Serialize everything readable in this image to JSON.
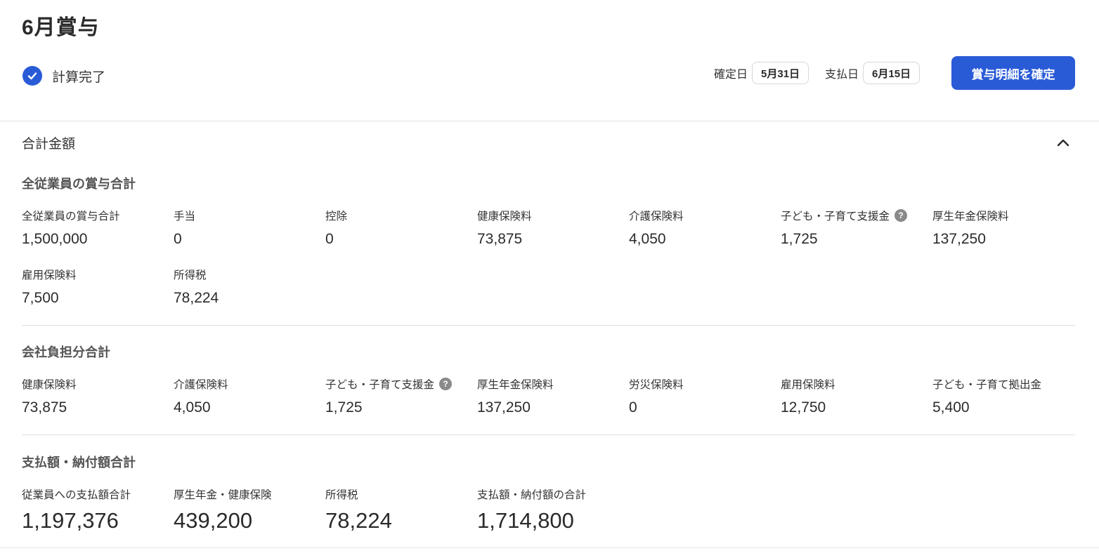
{
  "header": {
    "title": "6月賞与",
    "status_label": "計算完了",
    "confirm_date_label": "確定日",
    "confirm_date": "5月31日",
    "pay_date_label": "支払日",
    "pay_date": "6月15日",
    "confirm_button": "賞与明細を確定"
  },
  "summary": {
    "section_label": "合計金額",
    "employee_total": {
      "title": "全従業員の賞与合計",
      "items": [
        {
          "label": "全従業員の賞与合計",
          "value": "1,500,000"
        },
        {
          "label": "手当",
          "value": "0"
        },
        {
          "label": "控除",
          "value": "0"
        },
        {
          "label": "健康保険料",
          "value": "73,875"
        },
        {
          "label": "介護保険料",
          "value": "4,050"
        },
        {
          "label": "子ども・子育て支援金",
          "value": "1,725"
        },
        {
          "label": "厚生年金保険料",
          "value": "137,250"
        },
        {
          "label": "雇用保険料",
          "value": "7,500"
        },
        {
          "label": "所得税",
          "value": "78,224"
        }
      ]
    },
    "company_total": {
      "title": "会社負担分合計",
      "items": [
        {
          "label": "健康保険料",
          "value": "73,875"
        },
        {
          "label": "介護保険料",
          "value": "4,050"
        },
        {
          "label": "子ども・子育て支援金",
          "value": "1,725"
        },
        {
          "label": "厚生年金保険料",
          "value": "137,250"
        },
        {
          "label": "労災保険料",
          "value": "0"
        },
        {
          "label": "雇用保険料",
          "value": "12,750"
        },
        {
          "label": "子ども・子育て拠出金",
          "value": "5,400"
        }
      ]
    },
    "payment_total": {
      "title": "支払額・納付額合計",
      "items": [
        {
          "label": "従業員への支払額合計",
          "value": "1,197,376"
        },
        {
          "label": "厚生年金・健康保険",
          "value": "439,200"
        },
        {
          "label": "所得税",
          "value": "78,224"
        },
        {
          "label": "支払額・納付額の合計",
          "value": "1,714,800"
        }
      ]
    }
  },
  "icons": {
    "status": "check-circle-icon",
    "collapse": "chevron-up-icon",
    "help": "help-circle-icon"
  },
  "colors": {
    "accent": "#2a5bd7",
    "help_icon": "#8a8a8a"
  }
}
